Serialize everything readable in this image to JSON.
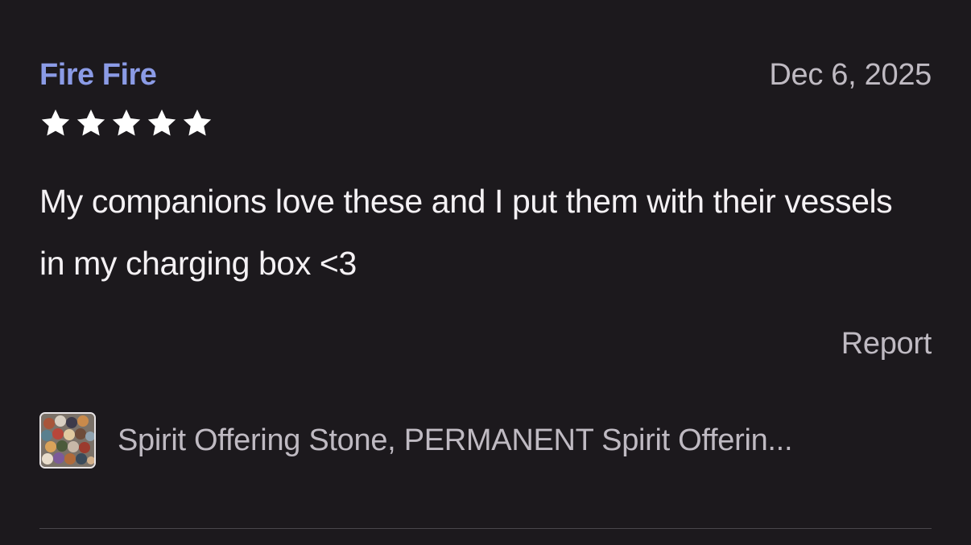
{
  "review": {
    "reviewer_name": "Fire Fire",
    "date": "Dec 6, 2025",
    "rating": 5,
    "rating_max": 5,
    "text": "My companions love these and I put them with their vessels in my charging box <3",
    "report_label": "Report"
  },
  "product": {
    "title": "Spirit Offering Stone, PERMANENT Spirit Offerin...",
    "thumbnail_icon": "crystal-stones-thumbnail"
  },
  "colors": {
    "background": "#1c191d",
    "reviewer_name": "#8b9be6",
    "secondary_text": "#bfbac2",
    "primary_text": "#f4f1f4",
    "star": "#ffffff"
  }
}
